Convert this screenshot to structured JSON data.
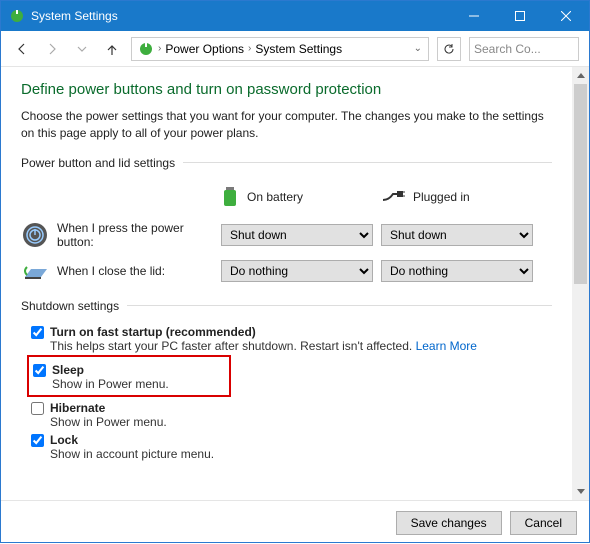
{
  "window": {
    "title": "System Settings"
  },
  "nav": {
    "crumb1": "Power Options",
    "crumb2": "System Settings",
    "search_placeholder": "Search Co..."
  },
  "heading": "Define power buttons and turn on password protection",
  "intro": "Choose the power settings that you want for your computer. The changes you make to the settings on this page apply to all of your power plans.",
  "group1_label": "Power button and lid settings",
  "col_battery": "On battery",
  "col_plugged": "Plugged in",
  "row_power_label": "When I press the power button:",
  "row_power_bat": "Shut down",
  "row_power_plug": "Shut down",
  "row_lid_label": "When I close the lid:",
  "row_lid_bat": "Do nothing",
  "row_lid_plug": "Do nothing",
  "group2_label": "Shutdown settings",
  "fast_title": "Turn on fast startup (recommended)",
  "fast_desc": "This helps start your PC faster after shutdown. Restart isn't affected. ",
  "fast_link": "Learn More",
  "sleep_title": "Sleep",
  "sleep_desc": "Show in Power menu.",
  "hib_title": "Hibernate",
  "hib_desc": "Show in Power menu.",
  "lock_title": "Lock",
  "lock_desc": "Show in account picture menu.",
  "btn_save": "Save changes",
  "btn_cancel": "Cancel"
}
